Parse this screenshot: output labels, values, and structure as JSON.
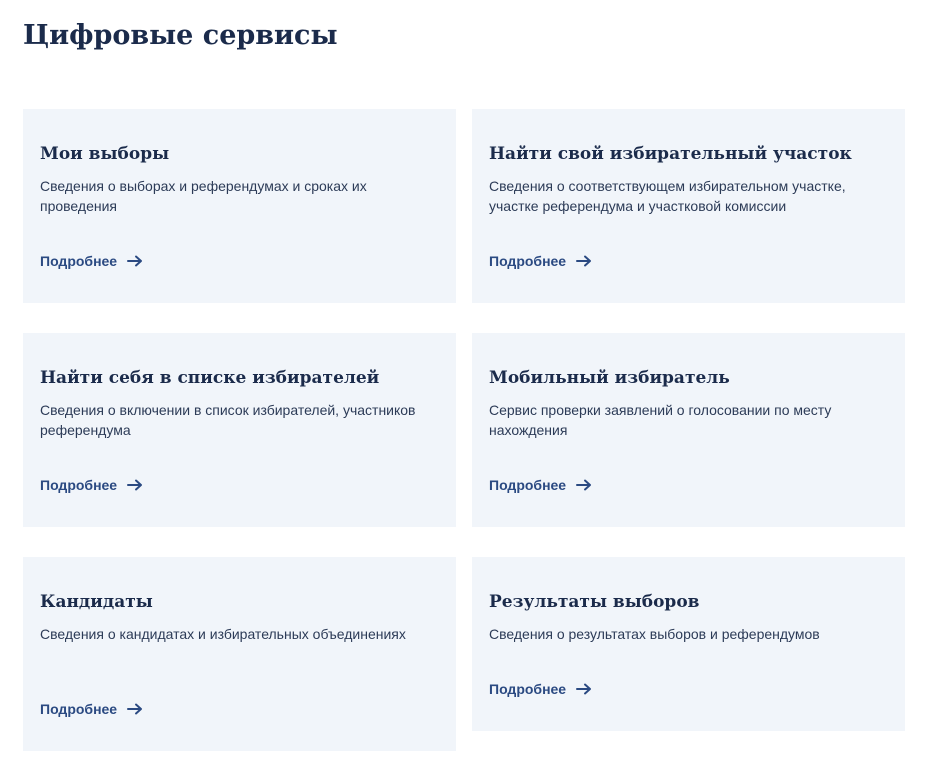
{
  "page": {
    "title": "Цифровые сервисы"
  },
  "colors": {
    "text_dark": "#1b2b4b",
    "link": "#2b4a82",
    "card_bg": "#f1f5fa"
  },
  "cards": [
    {
      "title": "Мои выборы",
      "description": "Сведения о выборах и референдумах и сроках их проведения",
      "link_label": "Подробнее",
      "link_icon": "arrow-right-icon"
    },
    {
      "title": "Найти свой избирательный участок",
      "description": "Сведения о соответствующем избирательном участке, участке референдума и участковой комиссии",
      "link_label": "Подробнее",
      "link_icon": "arrow-right-icon"
    },
    {
      "title": "Найти себя в списке избирателей",
      "description": "Сведения о включении в список избирателей, участников референдума",
      "link_label": "Подробнее",
      "link_icon": "arrow-right-icon"
    },
    {
      "title": "Мобильный избиратель",
      "description": "Сервис проверки заявлений о голосовании по месту нахождения",
      "link_label": "Подробнее",
      "link_icon": "arrow-right-icon"
    },
    {
      "title": "Кандидаты",
      "description": "Сведения о кандидатах и избирательных объединениях",
      "link_label": "Подробнее",
      "link_icon": "arrow-right-icon"
    },
    {
      "title": "Результаты выборов",
      "description": "Сведения о результатах выборов и референдумов",
      "link_label": "Подробнее",
      "link_icon": "arrow-right-icon"
    }
  ]
}
